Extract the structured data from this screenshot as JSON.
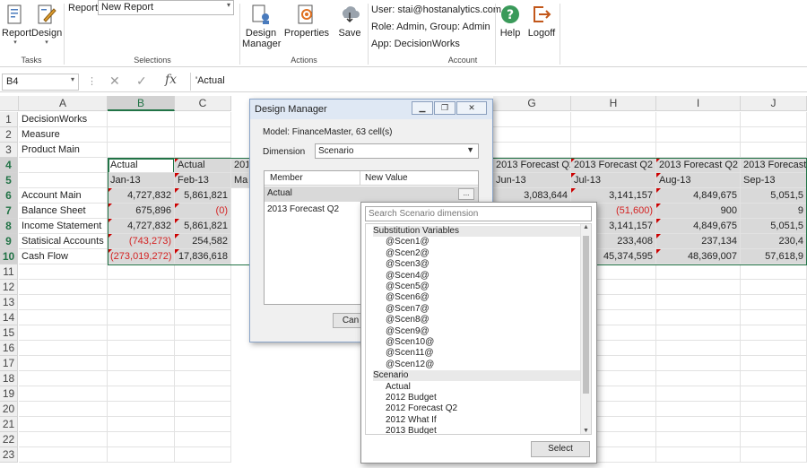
{
  "ribbon": {
    "report_label": "Report",
    "design_label": "Design",
    "tasks_group": "Tasks",
    "report_field_label": "Report",
    "report_select_value": "New Report",
    "selections_group": "Selections",
    "design_manager_label": "Design Manager",
    "properties_label": "Properties",
    "save_label": "Save",
    "actions_group": "Actions",
    "user_line": "User: stai@hostanalytics.com",
    "role_line": "Role: Admin, Group: Admin",
    "app_line": "App: DecisionWorks",
    "account_group": "Account",
    "help_label": "Help",
    "logoff_label": "Logoff"
  },
  "formula_bar": {
    "name_box": "B4",
    "fx": "fx",
    "content": "'Actual"
  },
  "grid": {
    "columns": [
      "A",
      "B",
      "C",
      "",
      "",
      "",
      "G",
      "H",
      "I",
      "J"
    ],
    "rows": [
      "1",
      "2",
      "3",
      "4",
      "5",
      "6",
      "7",
      "8",
      "9",
      "10",
      "11",
      "12",
      "13",
      "14",
      "15",
      "16",
      "17",
      "18",
      "19",
      "20",
      "21",
      "22",
      "23"
    ],
    "a_col": [
      "DecisionWorks",
      "Measure",
      "Product Main",
      "",
      "",
      "Account Main",
      "Balance Sheet",
      "Income Statement",
      "Statisical Accounts",
      "Cash Flow"
    ],
    "b_col": [
      "",
      "",
      "",
      "Actual",
      "Jan-13",
      "4,727,832",
      "675,896",
      "4,727,832",
      "(743,273)",
      "(273,019,272)"
    ],
    "c_col": [
      "",
      "",
      "",
      "Actual",
      "Feb-13",
      "5,861,821",
      "(0)",
      "5,861,821",
      "254,582",
      "17,836,618"
    ],
    "d_col": [
      "",
      "",
      "",
      "201",
      "Ma"
    ],
    "f_col": [
      "",
      "",
      "",
      "2013 Forecast Q2",
      "Jun-13",
      "3,083,644"
    ],
    "g_col": [
      "",
      "",
      "",
      "2013 Forecast Q2",
      "Jul-13",
      "3,141,157",
      "(51,600)",
      "3,141,157",
      "233,408",
      "45,374,595"
    ],
    "h_col": [
      "",
      "",
      "",
      "2013 Forecast Q2",
      "Aug-13",
      "4,849,675",
      "900",
      "4,849,675",
      "237,134",
      "48,369,007"
    ],
    "i_col": [
      "",
      "",
      "",
      "2013 Forecast",
      "Sep-13",
      "5,051,5",
      "9",
      "5,051,5",
      "230,4",
      "57,618,9"
    ]
  },
  "dialog": {
    "title": "Design Manager",
    "model_line": "Model: FinanceMaster, 63 cell(s)",
    "dimension_label": "Dimension",
    "dimension_value": "Scenario",
    "col_member": "Member",
    "col_new_value": "New Value",
    "rows": [
      {
        "member": "Actual",
        "new_value": ""
      },
      {
        "member": "2013 Forecast Q2",
        "new_value": ""
      }
    ],
    "ellipsis": "...",
    "cancel_partial": "Can"
  },
  "popup": {
    "search_placeholder": "Search Scenario dimension",
    "group1": "Substitution Variables",
    "vars": [
      "@Scen1@",
      "@Scen2@",
      "@Scen3@",
      "@Scen4@",
      "@Scen5@",
      "@Scen6@",
      "@Scen7@",
      "@Scen8@",
      "@Scen9@",
      "@Scen10@",
      "@Scen11@",
      "@Scen12@"
    ],
    "group2": "Scenario",
    "scenarios": [
      "Actual",
      "2012 Budget",
      "2012 Forecast Q2",
      "2012 What If",
      "2013 Budget"
    ],
    "select_label": "Select"
  },
  "colors": {
    "accent": "#217346",
    "negative": "#d42222",
    "header_fill": "#d9d9d9"
  },
  "icons": [
    "report-icon",
    "design-icon",
    "design-manager-icon",
    "properties-icon",
    "save-icon",
    "help-icon",
    "logoff-icon"
  ]
}
